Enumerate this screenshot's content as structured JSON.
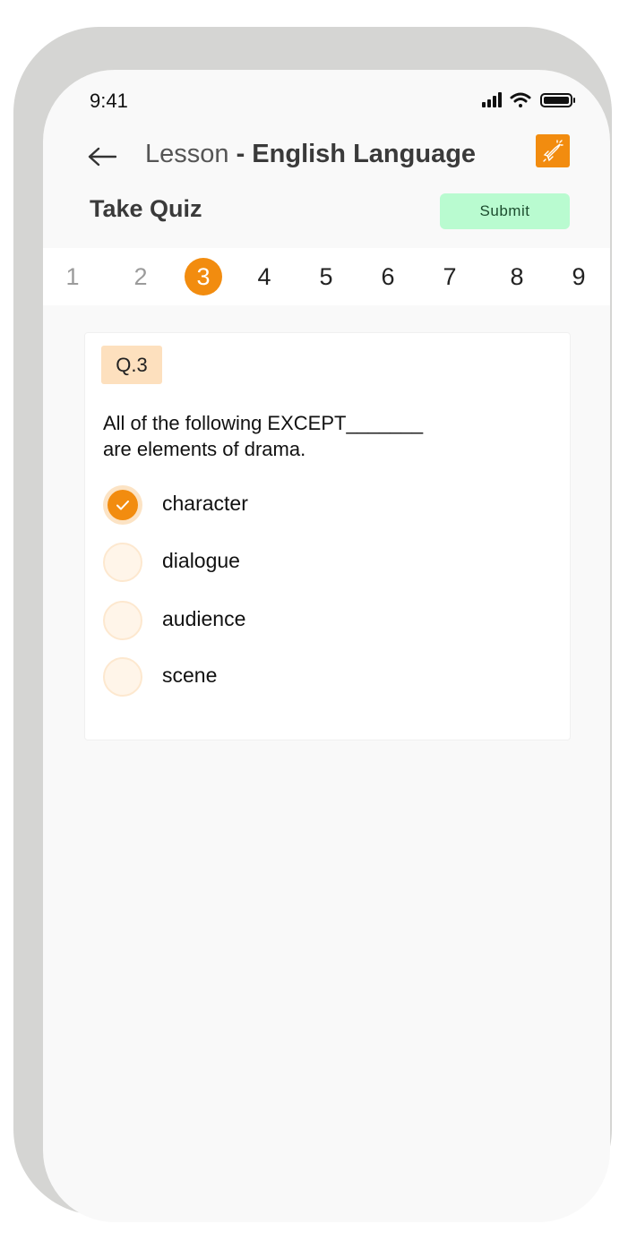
{
  "status_bar": {
    "time": "9:41"
  },
  "header": {
    "prefix": "Lesson",
    "separator": " - ",
    "title": "English Language",
    "back_icon": "arrow-left-icon",
    "action_icon": "rocket-icon"
  },
  "quiz": {
    "title": "Take Quiz",
    "submit_label": "Submit"
  },
  "question_nav": {
    "numbers": [
      "1",
      "2",
      "3",
      "4",
      "5",
      "6",
      "7",
      "8",
      "9"
    ],
    "active": "3"
  },
  "question": {
    "badge": "Q.3",
    "text_line1": "All of the following EXCEPT_______",
    "text_line2": "are elements of drama.",
    "options": [
      {
        "label": "character",
        "selected": true
      },
      {
        "label": "dialogue",
        "selected": false
      },
      {
        "label": "audience",
        "selected": false
      },
      {
        "label": "scene",
        "selected": false
      }
    ]
  },
  "colors": {
    "accent": "#f28c0f",
    "submit_bg": "#b9fbd0",
    "badge_bg": "#fde0be"
  }
}
